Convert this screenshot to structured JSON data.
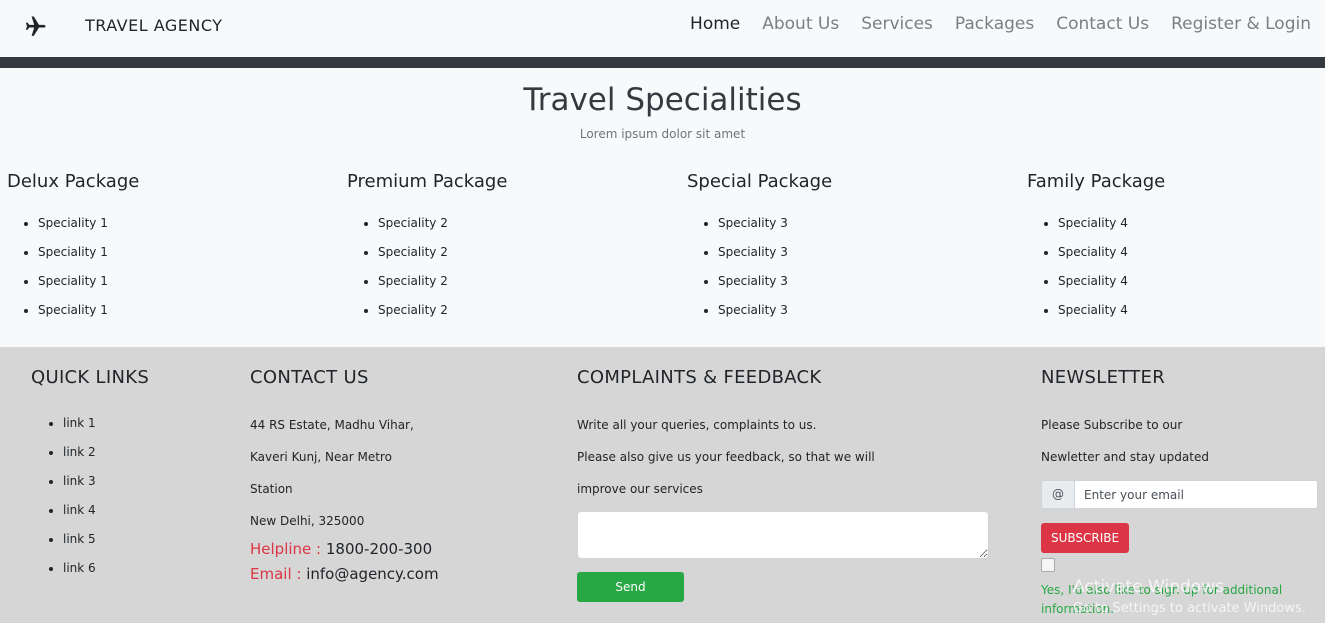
{
  "nav": {
    "brand": "TRAVEL AGENCY",
    "items": [
      {
        "label": "Home",
        "active": true
      },
      {
        "label": "About Us",
        "active": false
      },
      {
        "label": "Services",
        "active": false
      },
      {
        "label": "Packages",
        "active": false
      },
      {
        "label": "Contact Us",
        "active": false
      },
      {
        "label": "Register & Login",
        "active": false
      }
    ]
  },
  "specialities": {
    "title": "Travel Specialities",
    "subtitle": "Lorem ipsum dolor sit amet",
    "packages": [
      {
        "name": "Delux Package",
        "items": [
          "Speciality 1",
          "Speciality 1",
          "Speciality 1",
          "Speciality 1"
        ]
      },
      {
        "name": "Premium Package",
        "items": [
          "Speciality 2",
          "Speciality 2",
          "Speciality 2",
          "Speciality 2"
        ]
      },
      {
        "name": "Special Package",
        "items": [
          "Speciality 3",
          "Speciality 3",
          "Speciality 3",
          "Speciality 3"
        ]
      },
      {
        "name": "Family Package",
        "items": [
          "Speciality 4",
          "Speciality 4",
          "Speciality 4",
          "Speciality 4"
        ]
      }
    ]
  },
  "footer": {
    "quick_links": {
      "title": "QUICK LINKS",
      "links": [
        "link 1",
        "link 2",
        "link 3",
        "link 4",
        "link 5",
        "link 6"
      ]
    },
    "contact": {
      "title": "CONTACT US",
      "address": [
        "44 RS Estate, Madhu Vihar,",
        "Kaveri Kunj, Near Metro",
        "Station",
        "New Delhi, 325000"
      ],
      "helpline_label": "Helpline",
      "helpline_sep": " : ",
      "helpline_value": "1800-200-300",
      "email_label": "Email",
      "email_sep": " : ",
      "email_value": "info@agency.com"
    },
    "complaints": {
      "title": "COMPLAINTS & FEEDBACK",
      "lines": [
        "Write all your queries, complaints to us.",
        "Please also give us your feedback, so that we will",
        "improve our services"
      ],
      "textarea_value": "",
      "send_label": "Send"
    },
    "newsletter": {
      "title": "NEWSLETTER",
      "lines": [
        "Please Subscribe to our",
        "Newletter and stay updated"
      ],
      "prefix": "@",
      "email_placeholder": "Enter your email",
      "subscribe_label": "SUBSCRIBE",
      "checkbox_checked": false,
      "optin_text": "Yes, I'd also like to sign up for additional information."
    }
  },
  "watermark": {
    "line1": "Activate Windows",
    "line2": "Go to Settings to activate Windows."
  }
}
